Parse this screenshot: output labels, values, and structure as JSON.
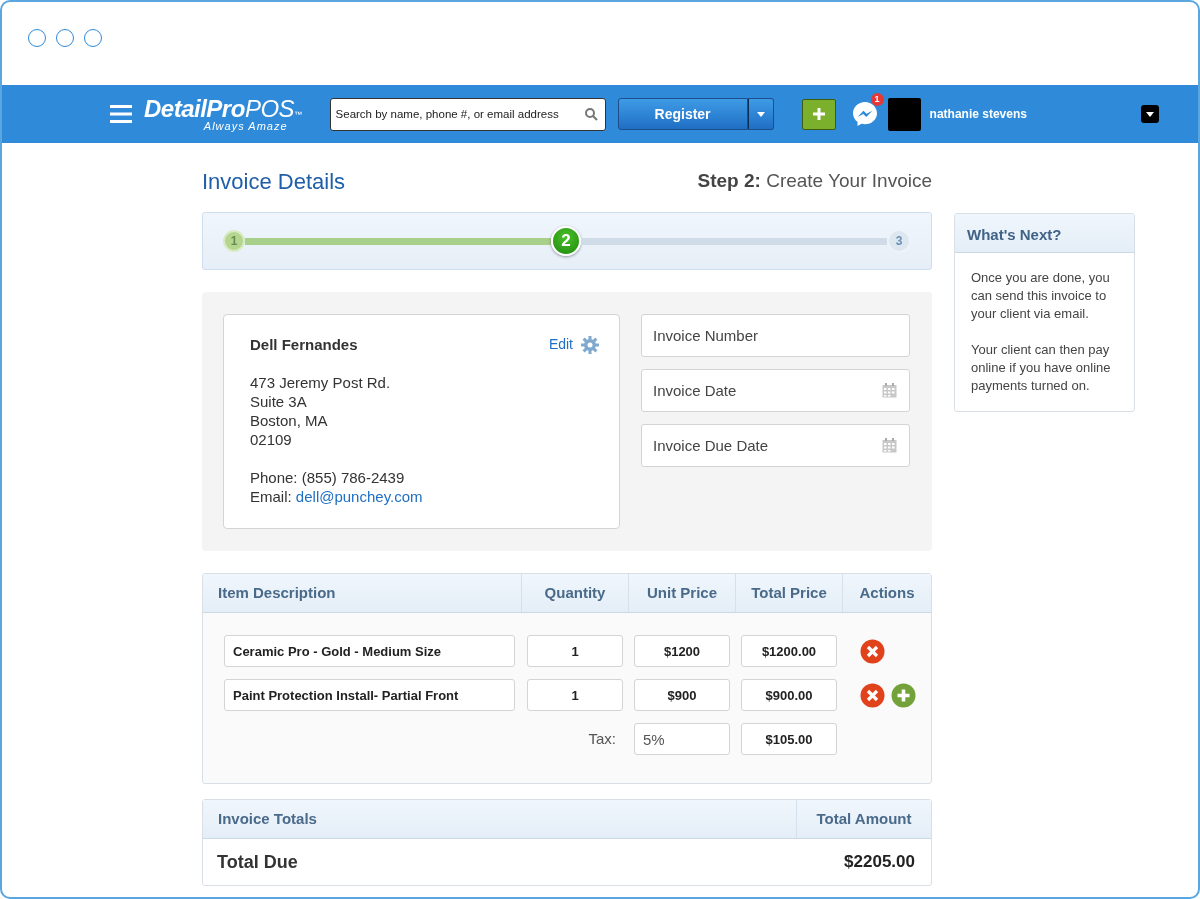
{
  "header": {
    "logo": {
      "name": "DetailPro",
      "suffix": "POS",
      "mark": "™",
      "tagline": "Always Amaze"
    },
    "search": {
      "placeholder": "Search by name, phone #, or email address"
    },
    "register_button": "Register",
    "notifications": "1",
    "user_name": "nathanie stevens"
  },
  "page": {
    "title": "Invoice Details",
    "step_label": "Step 2:",
    "step_title": "Create Your Invoice"
  },
  "progress": {
    "steps": [
      {
        "label": "1",
        "completed": true,
        "selected": false
      },
      {
        "label": "2",
        "completed": false,
        "selected": true
      },
      {
        "label": "3",
        "completed": false,
        "selected": false
      }
    ]
  },
  "customer": {
    "name": "Dell Fernandes",
    "edit": "Edit",
    "address": [
      "473 Jeremy Post Rd.",
      "Suite 3A",
      "Boston, MA",
      "02109"
    ],
    "phone_label": "Phone:",
    "phone": "(855) 786-2439",
    "email_label": "Email:",
    "email": "dell@punchey.com"
  },
  "invoice_fields": [
    {
      "placeholder": "Invoice Number",
      "kind": "text"
    },
    {
      "placeholder": "Invoice Date",
      "kind": "date"
    },
    {
      "placeholder": "Invoice Due Date",
      "kind": "date"
    }
  ],
  "items": {
    "columns": [
      "Item Description",
      "Quantity",
      "Unit Price",
      "Total Price",
      "Actions"
    ],
    "rows": [
      {
        "description": "Ceramic Pro - Gold - Medium Size",
        "quantity": "1",
        "unit_price": "$1200",
        "total_price": "$1200.00",
        "actions": [
          {
            "kind": "remove"
          }
        ]
      },
      {
        "description": "Paint Protection Install- Partial Front",
        "quantity": "1",
        "unit_price": "$900",
        "total_price": "$900.00",
        "actions": [
          {
            "kind": "remove"
          },
          {
            "kind": "add"
          }
        ]
      }
    ],
    "tax": {
      "label": "Tax:",
      "rate": "5%",
      "amount": "$105.00"
    }
  },
  "totals": {
    "columns": [
      "Invoice Totals",
      "Total Amount"
    ],
    "label": "Total Due",
    "amount": "$2205.00"
  },
  "sidebar": {
    "title": "What's Next?",
    "paragraphs": [
      "Once you are done, you can send this invoice to your client via email.",
      "Your client can then pay online if you have online payments turned on."
    ]
  }
}
